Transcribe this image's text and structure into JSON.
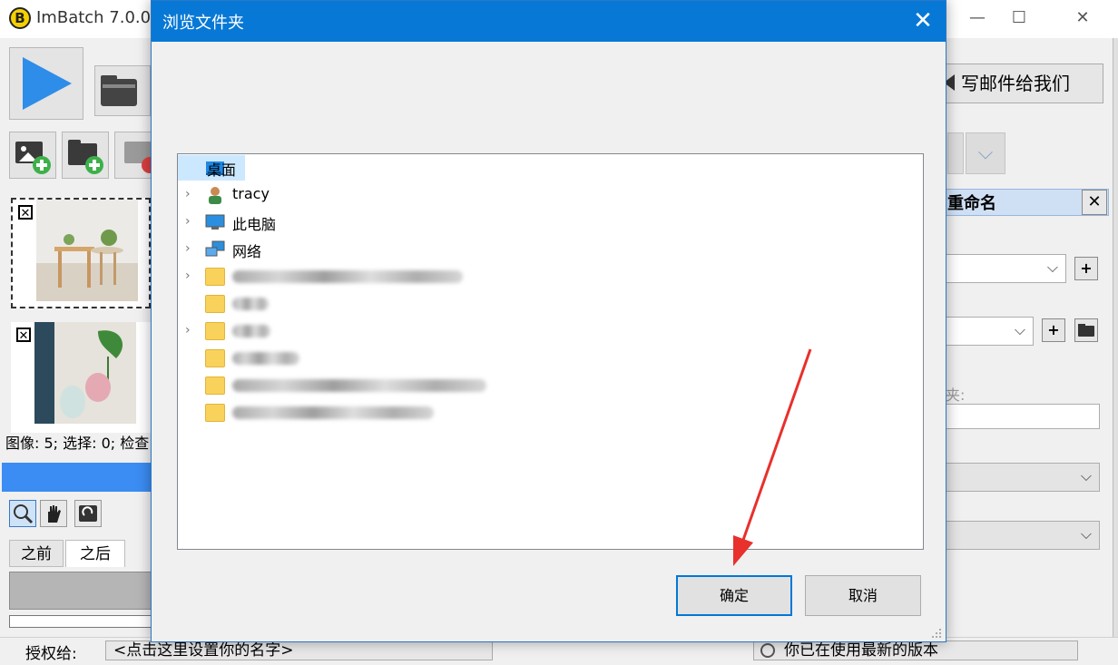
{
  "app": {
    "logo_letter": "B",
    "title": "ImBatch 7.0.0 [",
    "minimize_glyph": "—",
    "maximize_glyph": "☐",
    "close_glyph": "✕",
    "thumb_close_glyph": "✕",
    "status_line": "图像: 5; 选择: 0; 检查",
    "tab_before": "之前",
    "tab_after": "之后",
    "license_label": "授权给:",
    "license_value": "<点击这里设置你的名字>",
    "update_status": "你已在使用最新的版本",
    "mail_button": "写邮件给我们",
    "panel_title": "重命名",
    "panel_close_glyph": "✕",
    "field_label": "夹:",
    "chevron_glyph": "⌵",
    "plus_glyph": "+"
  },
  "dialog": {
    "title": "浏览文件夹",
    "close_glyph": "✕",
    "tree_items": [
      {
        "label": "桌面"
      },
      {
        "label": "tracy"
      },
      {
        "label": "此电脑"
      },
      {
        "label": "网络"
      }
    ],
    "expand_glyph": "›",
    "ok_label": "确定",
    "cancel_label": "取消"
  },
  "colors": {
    "dialog_title_bar": "#0878d6",
    "selection": "#cce8ff",
    "ok_border": "#0078d7",
    "annotation_arrow": "#e8302c",
    "progress_bar": "#3b8cf3"
  }
}
